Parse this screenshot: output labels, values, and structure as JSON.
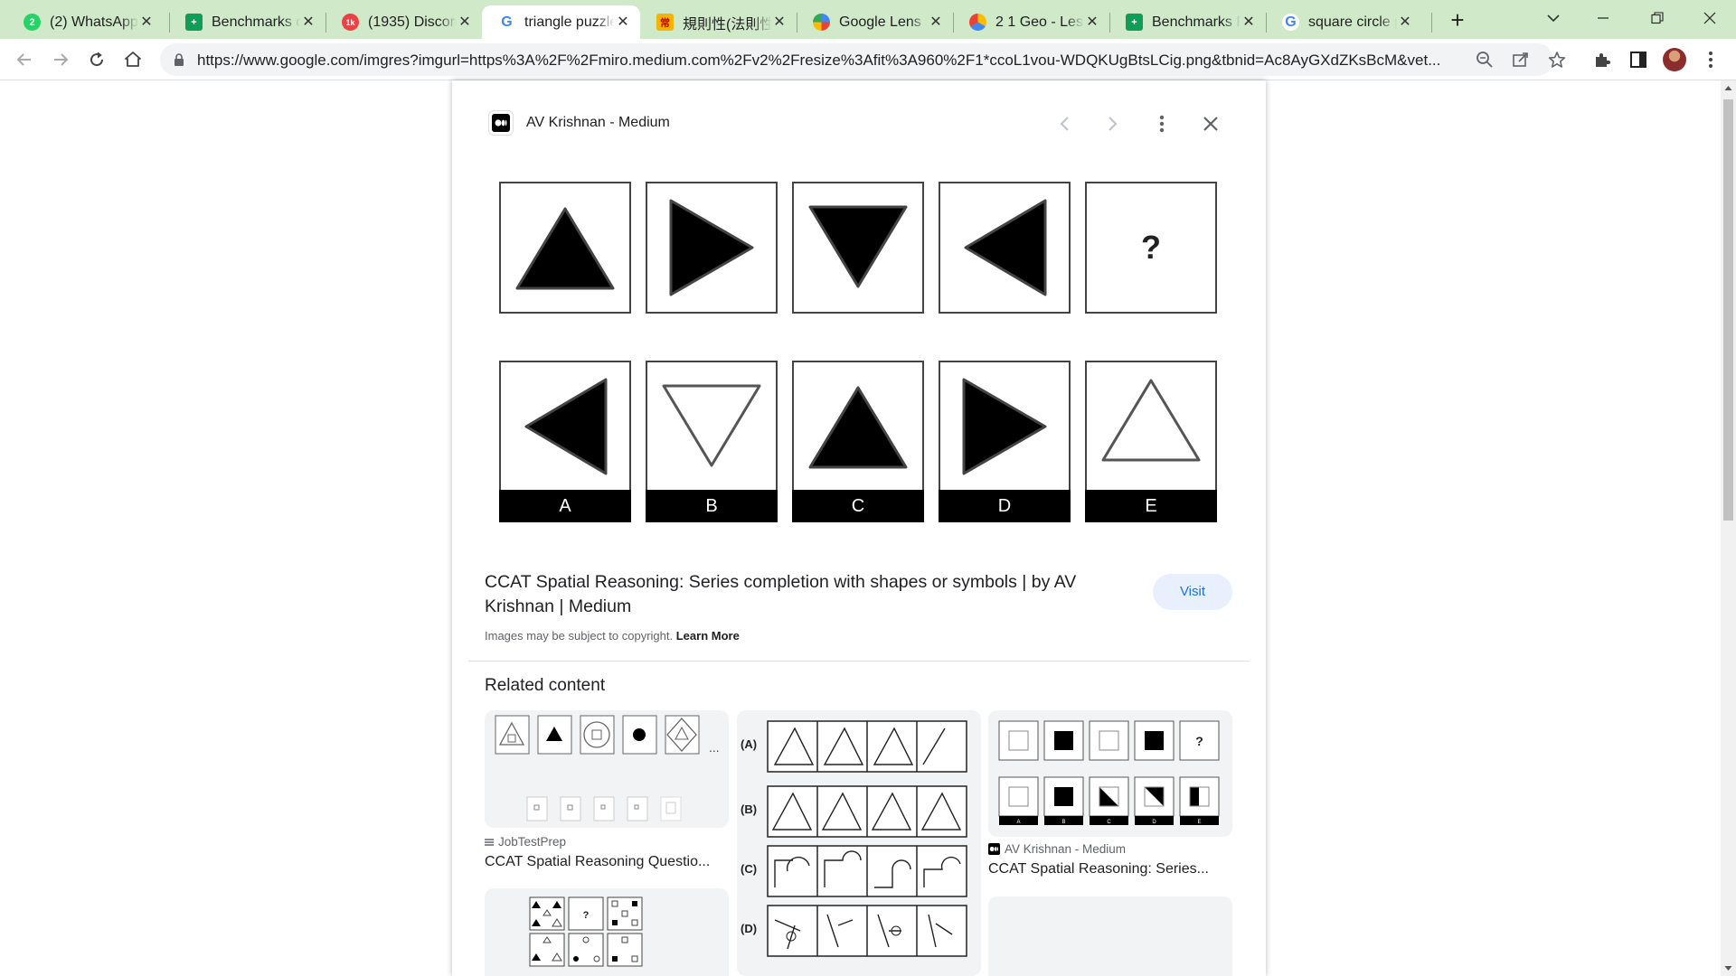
{
  "tabs": [
    {
      "title": "(2) WhatsApp",
      "fav_text": "2",
      "fav_color": "#25d366"
    },
    {
      "title": "Benchmarks d",
      "fav_text": "+",
      "fav_color": "#0f9d58"
    },
    {
      "title": "(1935) Discord",
      "fav_text": "1k",
      "fav_color": "#ed4245"
    },
    {
      "title": "triangle puzzle",
      "fav_text": "G",
      "fav_color": "#ffffff"
    },
    {
      "title": "規則性(法則性",
      "fav_text": "常",
      "fav_color": "#f4b400"
    },
    {
      "title": "Google Lens",
      "fav_text": "",
      "fav_color": "#4285f4"
    },
    {
      "title": "2 1 Geo - Less",
      "fav_text": "",
      "fav_color": "#fbbc04"
    },
    {
      "title": "Benchmarks R",
      "fav_text": "+",
      "fav_color": "#0f9d58"
    },
    {
      "title": "square circle p",
      "fav_text": "G",
      "fav_color": "#ffffff"
    }
  ],
  "address": {
    "url": "https://www.google.com/imgres?imgurl=https%3A%2F%2Fmiro.medium.com%2Fv2%2Fresize%3Afit%3A960%2F1*ccoL1vou-WDQKUgBtsLCig.png&tbnid=Ac8AyGXdZKsBcM&vet..."
  },
  "viewer": {
    "source": "AV Krishnan - Medium",
    "puzzle": {
      "question_mark": "?",
      "options": [
        "A",
        "B",
        "C",
        "D",
        "E"
      ]
    },
    "title": "CCAT Spatial Reasoning: Series completion with shapes or symbols | by AV Krishnan | Medium",
    "visit_label": "Visit",
    "copyright": "Images may be subject to copyright.",
    "learn_more": "Learn More",
    "related_heading": "Related content",
    "related": [
      {
        "source": "JobTestPrep",
        "title": "CCAT Spatial Reasoning Questio..."
      },
      {
        "source": "AV Krishnan - Medium",
        "title": "CCAT Spatial Reasoning: Series..."
      }
    ],
    "card2_labels": [
      "(A)",
      "(B)",
      "(C)",
      "(D)"
    ],
    "card3_question": "?",
    "card3_options": [
      "A",
      "B",
      "C",
      "D",
      "E"
    ],
    "card4_question": "?"
  },
  "colors": {
    "tabstrip": "#cfe9c9",
    "accent": "#1a73e8"
  }
}
